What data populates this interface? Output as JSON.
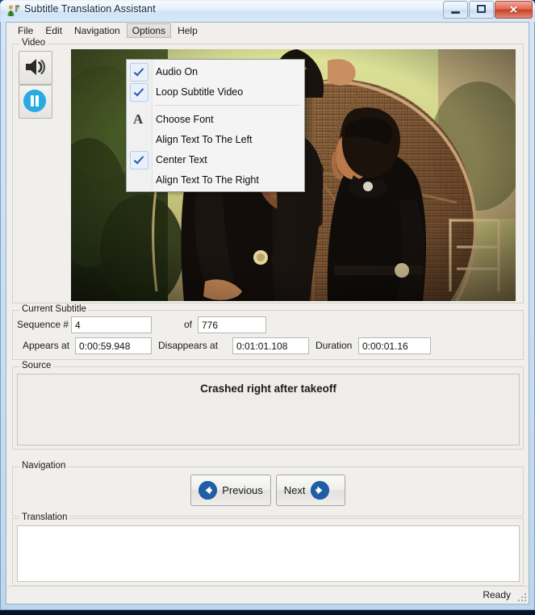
{
  "window": {
    "title": "Subtitle Translation Assistant",
    "icon": "app-person-icon",
    "minimize_label": "Minimize",
    "maximize_label": "Maximize",
    "close_label": "Close"
  },
  "menubar": {
    "items": [
      {
        "label": "File",
        "active": false
      },
      {
        "label": "Edit",
        "active": false
      },
      {
        "label": "Navigation",
        "active": false
      },
      {
        "label": "Options",
        "active": true
      },
      {
        "label": "Help",
        "active": false
      }
    ]
  },
  "options_menu": {
    "open": true,
    "items": [
      {
        "label": "Audio On",
        "checked": true,
        "icon": ""
      },
      {
        "label": "Loop Subtitle Video",
        "checked": true,
        "icon": ""
      },
      {
        "label": "Choose Font",
        "checked": false,
        "icon": "A"
      },
      {
        "label": "Align Text To The Left",
        "checked": false,
        "icon": ""
      },
      {
        "label": "Center Text",
        "checked": true,
        "icon": ""
      },
      {
        "label": "Align Text To The Right",
        "checked": false,
        "icon": ""
      }
    ]
  },
  "video": {
    "legend": "Video",
    "audio_button": "speaker-icon",
    "pause_button": "pause-icon",
    "scene_description": "Two men standing in front of an airboat fan cage outdoors"
  },
  "current_subtitle": {
    "legend": "Current Subtitle",
    "sequence_label": "Sequence #",
    "sequence_value": "4",
    "of_label": "of",
    "of_value": "776",
    "appears_label": "Appears at",
    "appears_value": "0:00:59.948",
    "disappears_label": "Disappears at",
    "disappears_value": "0:01:01.108",
    "duration_label": "Duration",
    "duration_value": "0:00:01.16"
  },
  "source": {
    "legend": "Source",
    "text": "Crashed right after takeoff"
  },
  "navigation": {
    "legend": "Navigation",
    "previous_label": "Previous",
    "next_label": "Next"
  },
  "translation": {
    "legend": "Translation",
    "text": ""
  },
  "statusbar": {
    "text": "Ready"
  },
  "colors": {
    "accent_blue": "#1f5ea3",
    "pause_blue": "#29abe2",
    "close_red": "#c94027",
    "panel_bg": "#f0efeb",
    "check_blue": "#2b57a6"
  }
}
